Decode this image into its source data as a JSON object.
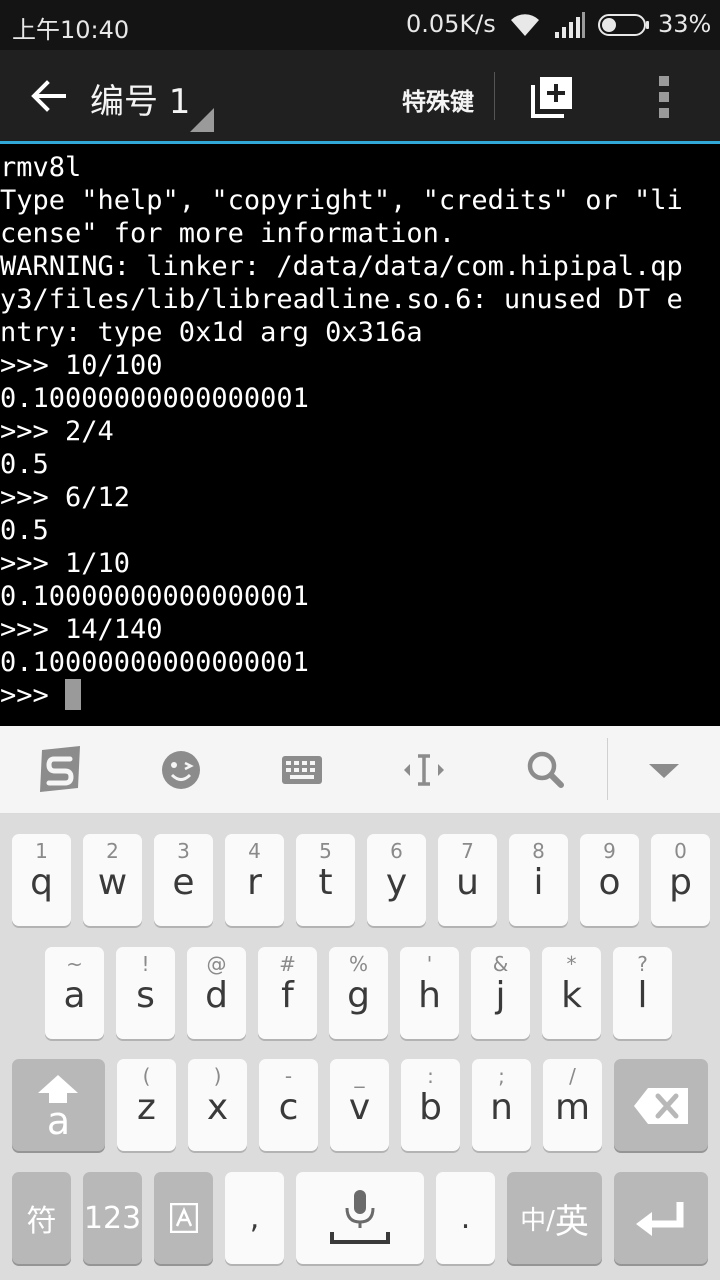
{
  "status_bar": {
    "time": "上午10:40",
    "net_speed": "0.05K/s",
    "battery_percent": "33%",
    "battery_level": 0.33
  },
  "app_bar": {
    "session_title": "编号 1",
    "special_keys_label": "特殊键"
  },
  "terminal": {
    "lines": [
      "rmv8l",
      "Type \"help\", \"copyright\", \"credits\" or \"li",
      "cense\" for more information.",
      "WARNING: linker: /data/data/com.hipipal.qp",
      "y3/files/lib/libreadline.so.6: unused DT e",
      "ntry: type 0x1d arg 0x316a",
      ">>> 10/100",
      "0.10000000000000001",
      ">>> 2/4",
      "0.5",
      ">>> 6/12",
      "0.5",
      ">>> 1/10",
      "0.10000000000000001",
      ">>> 14/140",
      "0.10000000000000001"
    ],
    "prompt": ">>> "
  },
  "keyboard": {
    "row1": [
      {
        "hint": "1",
        "key": "q"
      },
      {
        "hint": "2",
        "key": "w"
      },
      {
        "hint": "3",
        "key": "e"
      },
      {
        "hint": "4",
        "key": "r"
      },
      {
        "hint": "5",
        "key": "t"
      },
      {
        "hint": "6",
        "key": "y"
      },
      {
        "hint": "7",
        "key": "u"
      },
      {
        "hint": "8",
        "key": "i"
      },
      {
        "hint": "9",
        "key": "o"
      },
      {
        "hint": "0",
        "key": "p"
      }
    ],
    "row2": [
      {
        "hint": "~",
        "key": "a"
      },
      {
        "hint": "!",
        "key": "s"
      },
      {
        "hint": "@",
        "key": "d"
      },
      {
        "hint": "#",
        "key": "f"
      },
      {
        "hint": "%",
        "key": "g"
      },
      {
        "hint": "'",
        "key": "h"
      },
      {
        "hint": "&",
        "key": "j"
      },
      {
        "hint": "*",
        "key": "k"
      },
      {
        "hint": "?",
        "key": "l"
      }
    ],
    "row3": [
      {
        "hint": "(",
        "key": "z"
      },
      {
        "hint": ")",
        "key": "x"
      },
      {
        "hint": "-",
        "key": "c"
      },
      {
        "hint": "_",
        "key": "v"
      },
      {
        "hint": ":",
        "key": "b"
      },
      {
        "hint": ";",
        "key": "n"
      },
      {
        "hint": "/",
        "key": "m"
      }
    ],
    "shift_letter": "a",
    "symbols_label": "符",
    "numbers_label": "123",
    "comma_label": ",",
    "period_label": ".",
    "lang_label_cn": "中/",
    "lang_label_en": "英"
  }
}
